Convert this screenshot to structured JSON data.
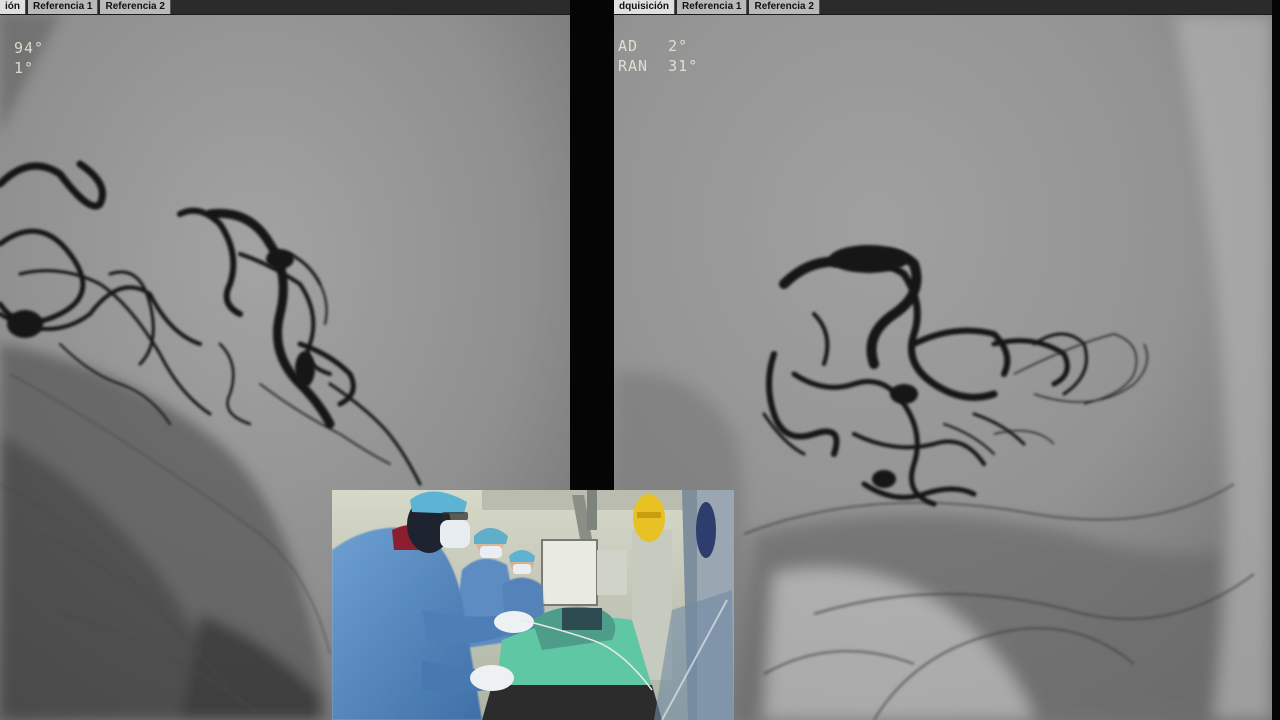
{
  "left_viewer": {
    "tabs": [
      {
        "label": "ión",
        "active": true
      },
      {
        "label": "Referencia 1",
        "active": false
      },
      {
        "label": "Referencia 2",
        "active": false
      }
    ],
    "readout": {
      "line1": "94°",
      "line2": "1°"
    }
  },
  "right_viewer": {
    "tabs": [
      {
        "label": "dquisición",
        "active": true
      },
      {
        "label": "Referencia 1",
        "active": false
      },
      {
        "label": "Referencia 2",
        "active": false
      }
    ],
    "readout": {
      "line1": "AD   2°",
      "line2": "RAN  31°"
    }
  },
  "colors": {
    "background": "#050505",
    "fluoro_gray": "#8e8e8e",
    "tab_bg": "#b9b9b9",
    "tab_active_bg": "#e0e0e0",
    "readout_text": "#f2f2e0",
    "contrast_vessel": "#141414",
    "surgical_gown": "#5b8fc4",
    "surgical_drape": "#5fc7a3"
  }
}
